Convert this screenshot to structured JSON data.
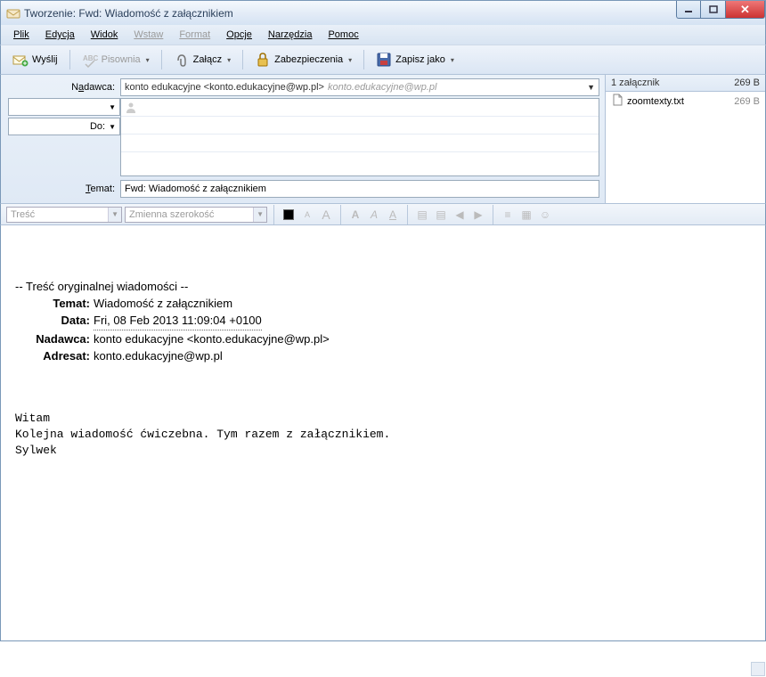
{
  "window": {
    "title": "Tworzenie: Fwd: Wiadomość z załącznikiem",
    "btn_min": "—",
    "btn_max": "▭",
    "btn_close": "✕"
  },
  "menu": {
    "file": "Plik",
    "edit": "Edycja",
    "view": "Widok",
    "insert": "Wstaw",
    "format": "Format",
    "options": "Opcje",
    "tools": "Narzędzia",
    "help": "Pomoc"
  },
  "toolbar": {
    "send": "Wyślij",
    "spelling": "Pisownia",
    "attach": "Załącz",
    "security": "Zabezpieczenia",
    "saveas": "Zapisz jako"
  },
  "header": {
    "from_label": "Nadawca:",
    "from_value": "konto edukacyjne <konto.edukacyjne@wp.pl>",
    "from_hint": "konto.edukacyjne@wp.pl",
    "to_label": "Do:",
    "subject_label": "Temat:",
    "subject_value": "Fwd: Wiadomość z załącznikiem"
  },
  "attachments": {
    "header": "1 załącznik",
    "total_size": "269 B",
    "items": [
      {
        "name": "zoomtexty.txt",
        "size": "269 B"
      }
    ]
  },
  "format": {
    "style": "Treść",
    "font": "Zmienna szerokość"
  },
  "body": {
    "orig_intro": "-- Treść oryginalnej wiadomości --",
    "k_subject": "Temat:",
    "v_subject": "Wiadomość z załącznikiem",
    "k_date": "Data:",
    "v_date": "Fri, 08 Feb 2013 11:09:04 +0100",
    "k_from": "Nadawca:",
    "v_from": "konto edukacyjne <konto.edukacyjne@wp.pl>",
    "k_to": "Adresat:",
    "v_to": "konto.edukacyjne@wp.pl",
    "text": "Witam\nKolejna wiadomość ćwiczebna. Tym razem z załącznikiem.\nSylwek"
  }
}
